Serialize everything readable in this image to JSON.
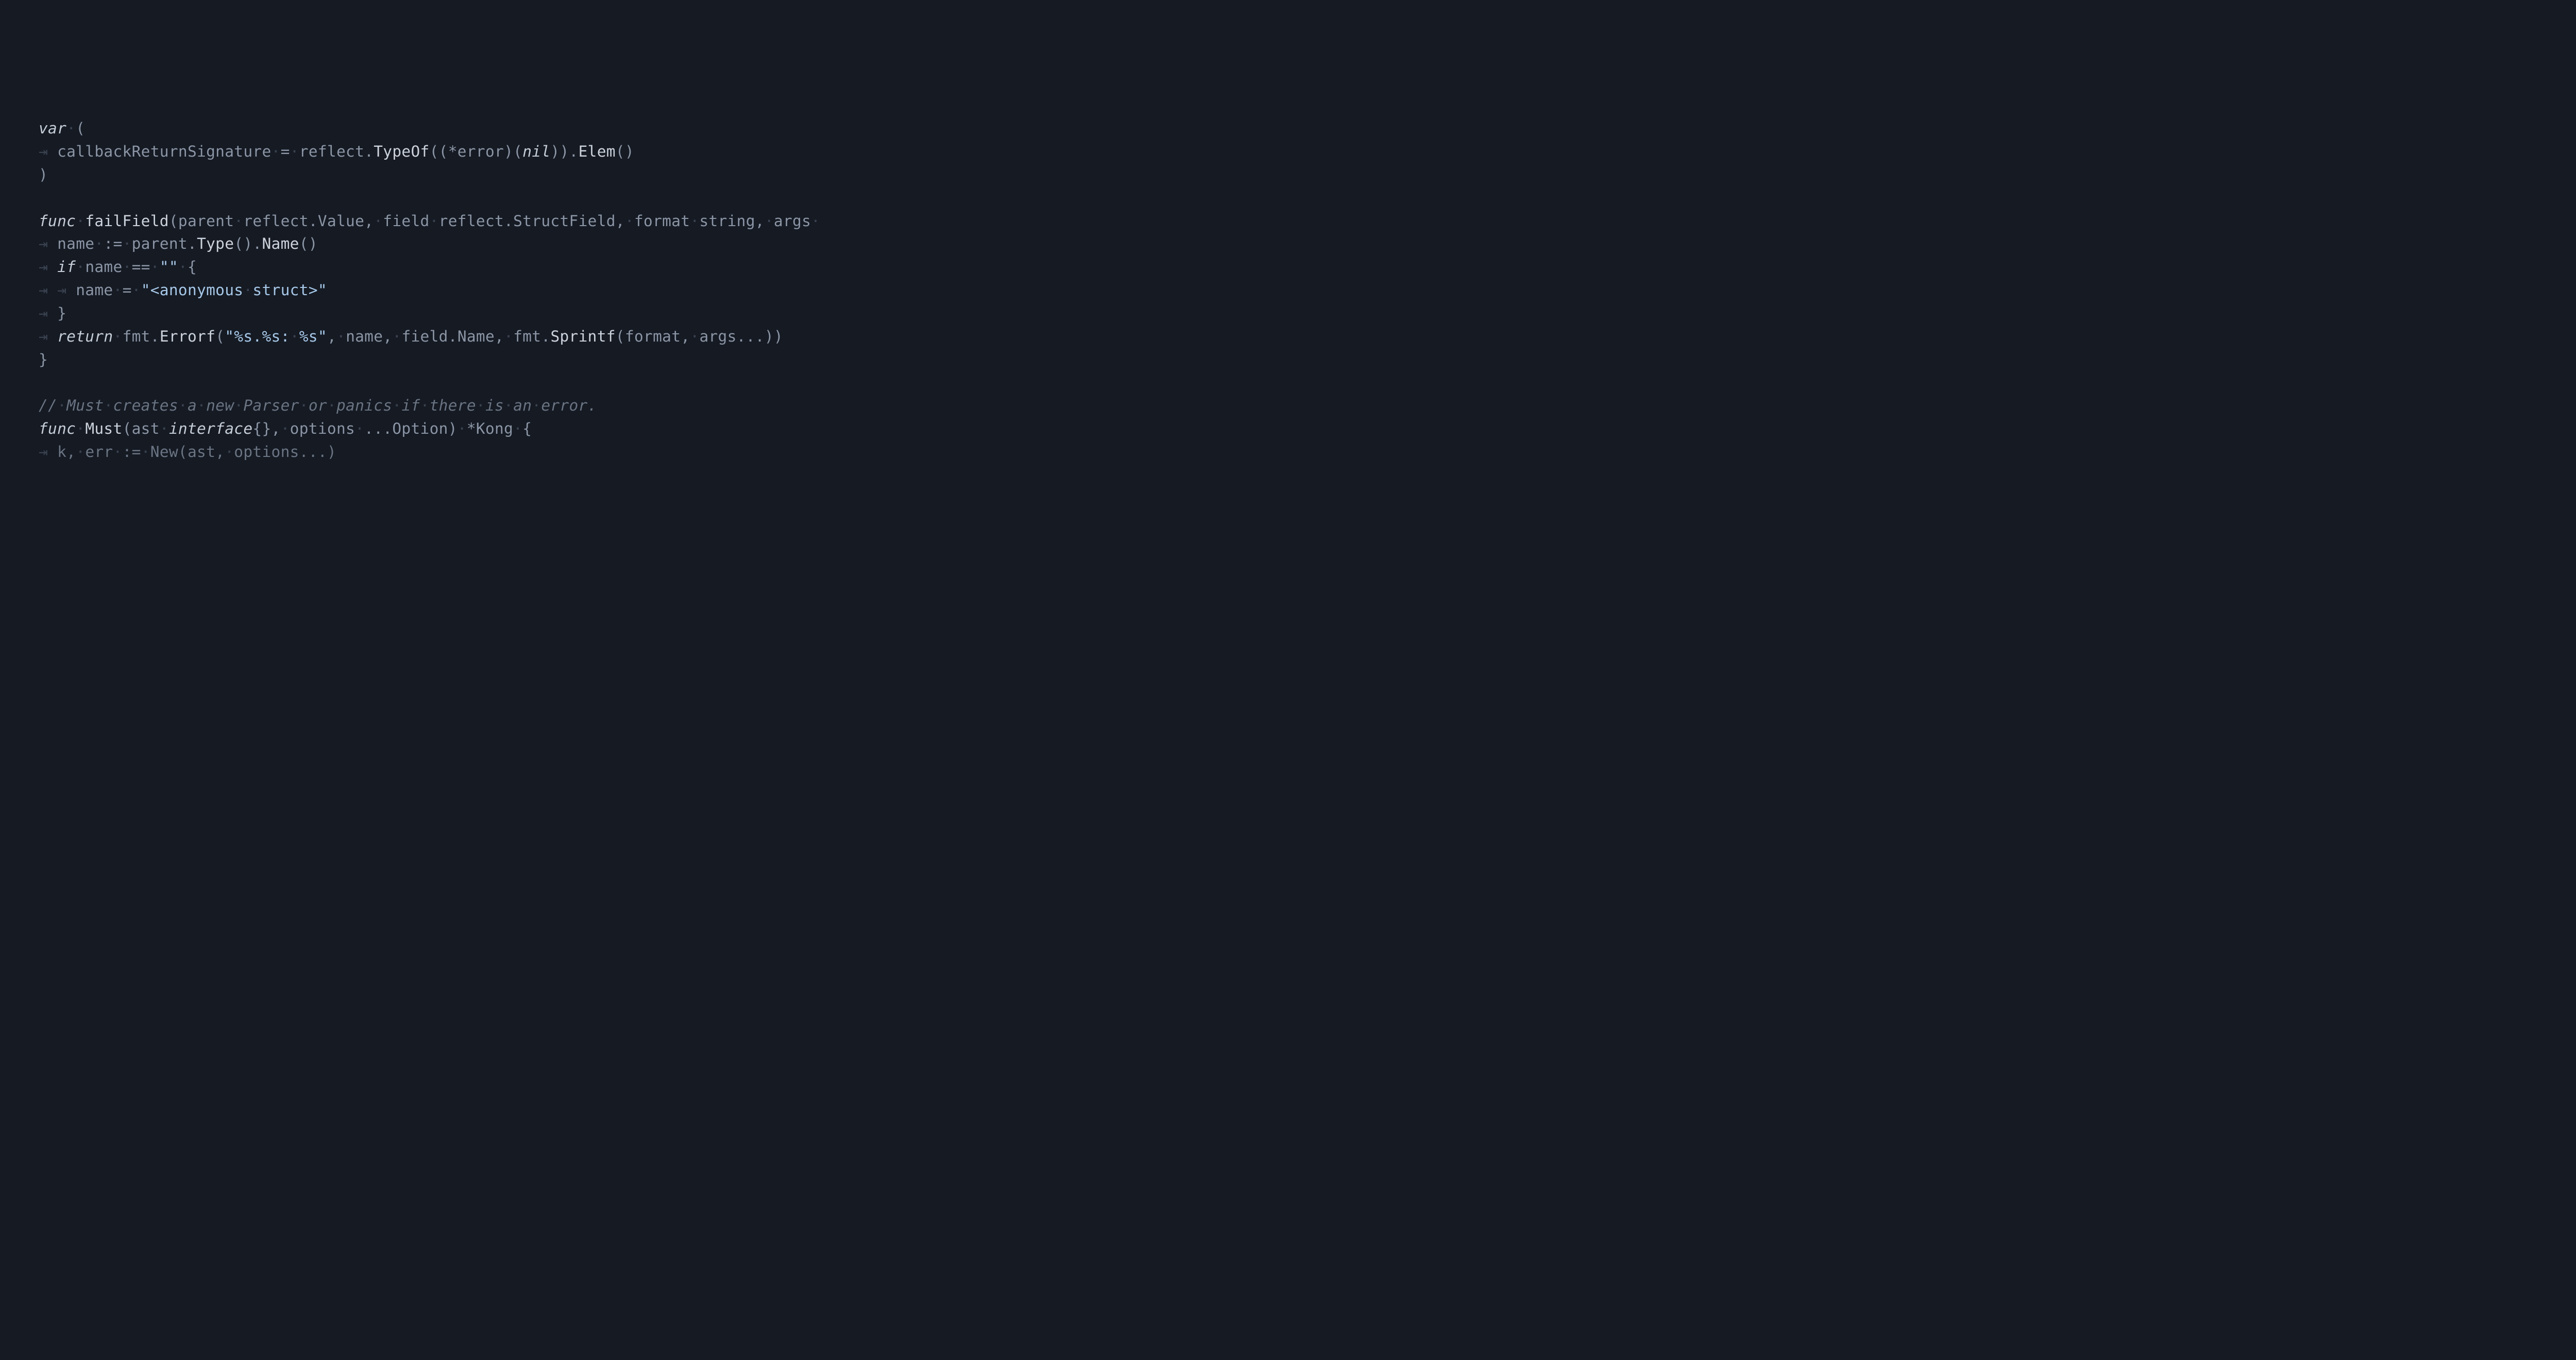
{
  "code": {
    "lines": [
      {
        "level": 0,
        "tokens": [
          {
            "cls": "kw",
            "t": "var"
          },
          {
            "cls": "ws",
            "t": "·"
          },
          {
            "cls": "pun",
            "t": "("
          }
        ]
      },
      {
        "level": 1,
        "tokens": [
          {
            "cls": "id",
            "t": "callbackReturnSignature"
          },
          {
            "cls": "ws",
            "t": "·"
          },
          {
            "cls": "op",
            "t": "="
          },
          {
            "cls": "ws",
            "t": "·"
          },
          {
            "cls": "id",
            "t": "reflect"
          },
          {
            "cls": "pun",
            "t": "."
          },
          {
            "cls": "fn",
            "t": "TypeOf"
          },
          {
            "cls": "pun",
            "t": "(("
          },
          {
            "cls": "op",
            "t": "*"
          },
          {
            "cls": "typ",
            "t": "error"
          },
          {
            "cls": "pun",
            "t": ")("
          },
          {
            "cls": "kw",
            "t": "nil"
          },
          {
            "cls": "pun",
            "t": "))."
          },
          {
            "cls": "fn",
            "t": "Elem"
          },
          {
            "cls": "pun",
            "t": "()"
          }
        ]
      },
      {
        "level": 0,
        "tokens": [
          {
            "cls": "pun",
            "t": ")"
          }
        ]
      },
      {
        "level": 0,
        "tokens": []
      },
      {
        "level": 0,
        "tokens": [
          {
            "cls": "kw",
            "t": "func"
          },
          {
            "cls": "ws",
            "t": "·"
          },
          {
            "cls": "fn",
            "t": "failField"
          },
          {
            "cls": "pun",
            "t": "("
          },
          {
            "cls": "id",
            "t": "parent"
          },
          {
            "cls": "ws",
            "t": "·"
          },
          {
            "cls": "id",
            "t": "reflect"
          },
          {
            "cls": "pun",
            "t": "."
          },
          {
            "cls": "typ",
            "t": "Value"
          },
          {
            "cls": "pun",
            "t": ","
          },
          {
            "cls": "ws",
            "t": "·"
          },
          {
            "cls": "id",
            "t": "field"
          },
          {
            "cls": "ws",
            "t": "·"
          },
          {
            "cls": "id",
            "t": "reflect"
          },
          {
            "cls": "pun",
            "t": "."
          },
          {
            "cls": "typ",
            "t": "StructField"
          },
          {
            "cls": "pun",
            "t": ","
          },
          {
            "cls": "ws",
            "t": "·"
          },
          {
            "cls": "id",
            "t": "format"
          },
          {
            "cls": "ws",
            "t": "·"
          },
          {
            "cls": "typ",
            "t": "string"
          },
          {
            "cls": "pun",
            "t": ","
          },
          {
            "cls": "ws",
            "t": "·"
          },
          {
            "cls": "id",
            "t": "args"
          },
          {
            "cls": "ws",
            "t": "·"
          }
        ]
      },
      {
        "level": 1,
        "tokens": [
          {
            "cls": "id",
            "t": "name"
          },
          {
            "cls": "ws",
            "t": "·"
          },
          {
            "cls": "op",
            "t": ":="
          },
          {
            "cls": "ws",
            "t": "·"
          },
          {
            "cls": "id",
            "t": "parent"
          },
          {
            "cls": "pun",
            "t": "."
          },
          {
            "cls": "fn",
            "t": "Type"
          },
          {
            "cls": "pun",
            "t": "()."
          },
          {
            "cls": "fn",
            "t": "Name"
          },
          {
            "cls": "pun",
            "t": "()"
          }
        ]
      },
      {
        "level": 1,
        "tokens": [
          {
            "cls": "kw",
            "t": "if"
          },
          {
            "cls": "ws",
            "t": "·"
          },
          {
            "cls": "id",
            "t": "name"
          },
          {
            "cls": "ws",
            "t": "·"
          },
          {
            "cls": "op",
            "t": "=="
          },
          {
            "cls": "ws",
            "t": "·"
          },
          {
            "cls": "str",
            "t": "\"\""
          },
          {
            "cls": "ws",
            "t": "·"
          },
          {
            "cls": "pun",
            "t": "{"
          }
        ]
      },
      {
        "level": 2,
        "tokens": [
          {
            "cls": "id",
            "t": "name"
          },
          {
            "cls": "ws",
            "t": "·"
          },
          {
            "cls": "op",
            "t": "="
          },
          {
            "cls": "ws",
            "t": "·"
          },
          {
            "cls": "str",
            "t": "\"<anonymous"
          },
          {
            "cls": "ws",
            "t": "·"
          },
          {
            "cls": "str",
            "t": "struct>\""
          }
        ]
      },
      {
        "level": 1,
        "tokens": [
          {
            "cls": "pun",
            "t": "}"
          }
        ]
      },
      {
        "level": 1,
        "tokens": [
          {
            "cls": "kw",
            "t": "return"
          },
          {
            "cls": "ws",
            "t": "·"
          },
          {
            "cls": "id",
            "t": "fmt"
          },
          {
            "cls": "pun",
            "t": "."
          },
          {
            "cls": "fn",
            "t": "Errorf"
          },
          {
            "cls": "pun",
            "t": "("
          },
          {
            "cls": "str",
            "t": "\"%s.%s:"
          },
          {
            "cls": "ws",
            "t": "·"
          },
          {
            "cls": "str",
            "t": "%s\""
          },
          {
            "cls": "pun",
            "t": ","
          },
          {
            "cls": "ws",
            "t": "·"
          },
          {
            "cls": "id",
            "t": "name"
          },
          {
            "cls": "pun",
            "t": ","
          },
          {
            "cls": "ws",
            "t": "·"
          },
          {
            "cls": "id",
            "t": "field"
          },
          {
            "cls": "pun",
            "t": "."
          },
          {
            "cls": "id",
            "t": "Name"
          },
          {
            "cls": "pun",
            "t": ","
          },
          {
            "cls": "ws",
            "t": "·"
          },
          {
            "cls": "id",
            "t": "fmt"
          },
          {
            "cls": "pun",
            "t": "."
          },
          {
            "cls": "fn",
            "t": "Sprintf"
          },
          {
            "cls": "pun",
            "t": "("
          },
          {
            "cls": "id",
            "t": "format"
          },
          {
            "cls": "pun",
            "t": ","
          },
          {
            "cls": "ws",
            "t": "·"
          },
          {
            "cls": "id",
            "t": "args"
          },
          {
            "cls": "pun",
            "t": "...))"
          }
        ]
      },
      {
        "level": 0,
        "tokens": [
          {
            "cls": "pun",
            "t": "}"
          }
        ]
      },
      {
        "level": 0,
        "tokens": []
      },
      {
        "level": 0,
        "tokens": [
          {
            "cls": "com",
            "t": "//"
          },
          {
            "cls": "ws",
            "t": "·"
          },
          {
            "cls": "com",
            "t": "Must"
          },
          {
            "cls": "ws",
            "t": "·"
          },
          {
            "cls": "com",
            "t": "creates"
          },
          {
            "cls": "ws",
            "t": "·"
          },
          {
            "cls": "com",
            "t": "a"
          },
          {
            "cls": "ws",
            "t": "·"
          },
          {
            "cls": "com",
            "t": "new"
          },
          {
            "cls": "ws",
            "t": "·"
          },
          {
            "cls": "com",
            "t": "Parser"
          },
          {
            "cls": "ws",
            "t": "·"
          },
          {
            "cls": "com",
            "t": "or"
          },
          {
            "cls": "ws",
            "t": "·"
          },
          {
            "cls": "com",
            "t": "panics"
          },
          {
            "cls": "ws",
            "t": "·"
          },
          {
            "cls": "com",
            "t": "if"
          },
          {
            "cls": "ws",
            "t": "·"
          },
          {
            "cls": "com",
            "t": "there"
          },
          {
            "cls": "ws",
            "t": "·"
          },
          {
            "cls": "com",
            "t": "is"
          },
          {
            "cls": "ws",
            "t": "·"
          },
          {
            "cls": "com",
            "t": "an"
          },
          {
            "cls": "ws",
            "t": "·"
          },
          {
            "cls": "com",
            "t": "error."
          }
        ]
      },
      {
        "level": 0,
        "tokens": [
          {
            "cls": "kw",
            "t": "func"
          },
          {
            "cls": "ws",
            "t": "·"
          },
          {
            "cls": "fn",
            "t": "Must"
          },
          {
            "cls": "pun",
            "t": "("
          },
          {
            "cls": "id",
            "t": "ast"
          },
          {
            "cls": "ws",
            "t": "·"
          },
          {
            "cls": "kw",
            "t": "interface"
          },
          {
            "cls": "pun",
            "t": "{},"
          },
          {
            "cls": "ws",
            "t": "·"
          },
          {
            "cls": "id",
            "t": "options"
          },
          {
            "cls": "ws",
            "t": "·"
          },
          {
            "cls": "pun",
            "t": "..."
          },
          {
            "cls": "typ",
            "t": "Option"
          },
          {
            "cls": "pun",
            "t": ")"
          },
          {
            "cls": "ws",
            "t": "·"
          },
          {
            "cls": "op",
            "t": "*"
          },
          {
            "cls": "typ",
            "t": "Kong"
          },
          {
            "cls": "ws",
            "t": "·"
          },
          {
            "cls": "pun",
            "t": "{"
          }
        ]
      },
      {
        "level": 1,
        "cut": true,
        "tokens": [
          {
            "cls": "dim",
            "t": "k,"
          },
          {
            "cls": "ws",
            "t": "·"
          },
          {
            "cls": "dim",
            "t": "err"
          },
          {
            "cls": "ws",
            "t": "·"
          },
          {
            "cls": "dim",
            "t": ":="
          },
          {
            "cls": "ws",
            "t": "·"
          },
          {
            "cls": "dim",
            "t": "New(ast,"
          },
          {
            "cls": "ws",
            "t": "·"
          },
          {
            "cls": "dim",
            "t": "options...)"
          }
        ]
      }
    ]
  },
  "indent_glyph": "⇥ "
}
